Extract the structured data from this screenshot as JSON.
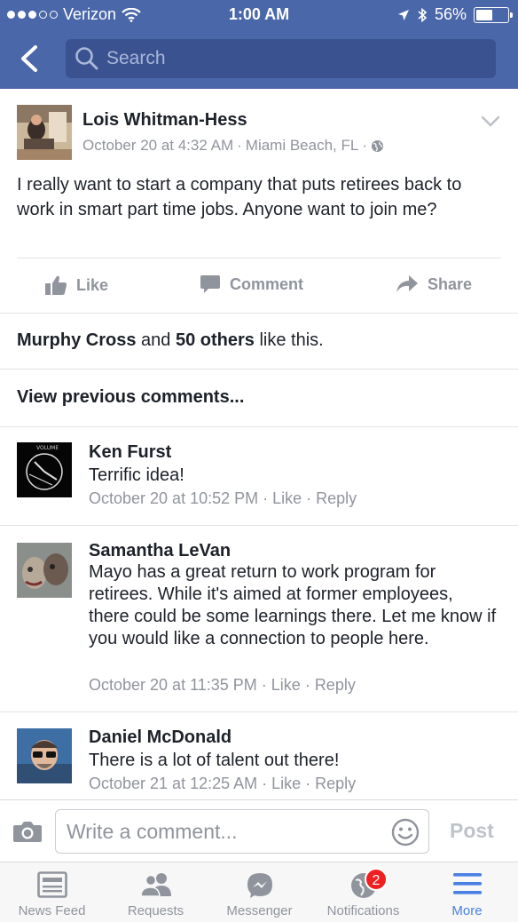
{
  "status_bar": {
    "carrier": "Verizon",
    "time": "1:00 AM",
    "battery": "56%",
    "battery_level": 0.56
  },
  "header": {
    "search_placeholder": "Search"
  },
  "post": {
    "author": "Lois Whitman-Hess",
    "date": "October 20 at 4:32 AM",
    "location": "Miami Beach, FL",
    "text": "I really want to start a company that puts retirees back to work in smart part time jobs. Anyone want to join me?",
    "actions": {
      "like": "Like",
      "comment": "Comment",
      "share": "Share"
    },
    "likes_summary": {
      "name": "Murphy Cross",
      "and": " and ",
      "others": "50 others",
      "suffix": " like this."
    },
    "view_previous": "View previous comments..."
  },
  "comments": [
    {
      "name": "Ken Furst",
      "text": "Terrific idea!",
      "date": "October 20 at 10:52 PM",
      "like": "Like",
      "reply": "Reply"
    },
    {
      "name": "Samantha LeVan",
      "text": "Mayo has a great return to work program for retirees. While it's aimed at former employees, there could be some learnings there. Let me know if you would like a connection to people here.",
      "date": "October 20 at 11:35 PM",
      "like": "Like",
      "reply": "Reply"
    },
    {
      "name": "Daniel McDonald",
      "text": "There is a lot of talent out there!",
      "date": "October 21 at 12:25 AM",
      "like": "Like",
      "reply": "Reply"
    }
  ],
  "composer": {
    "placeholder": "Write a comment...",
    "post_label": "Post"
  },
  "tabs": [
    {
      "label": "News Feed",
      "icon": "news-feed-icon"
    },
    {
      "label": "Requests",
      "icon": "requests-icon"
    },
    {
      "label": "Messenger",
      "icon": "messenger-icon"
    },
    {
      "label": "Notifications",
      "icon": "notifications-icon",
      "badge": "2"
    },
    {
      "label": "More",
      "icon": "menu-icon",
      "active": true
    }
  ],
  "colors": {
    "header_bg": "#4a67a9",
    "accent": "#4a80e4",
    "badge": "#f02020",
    "muted_text": "#90949c"
  }
}
